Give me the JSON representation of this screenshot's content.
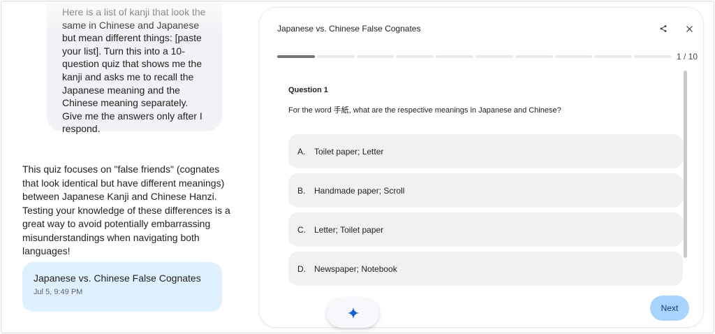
{
  "chat": {
    "user_prompt": "Here is a list of kanji that look the same in Chinese and Japanese but mean different things: [paste your list]. Turn this into a 10-question quiz that shows me the kanji and asks me to recall the Japanese meaning and the Chinese meaning separately. Give me the answers only after I respond.",
    "model_response": "This quiz focuses on \"false friends\" (cognates that look identical but have different meanings) between Japanese Kanji and Chinese Hanzi. Testing your knowledge of these differences is a great way to avoid potentially embarrassing misunderstandings when navigating both languages!",
    "quiz_chip": {
      "title": "Japanese vs. Chinese False Cognates",
      "date": "Jul 5, 9:49 PM"
    }
  },
  "panel": {
    "title": "Japanese vs. Chinese False Cognates",
    "share_icon": "share-icon",
    "close_icon": "close-icon",
    "progress": {
      "current": 1,
      "total": 10,
      "label": "1 / 10"
    },
    "question": {
      "number_label": "Question 1",
      "text": "For the word 手紙, what are the respective meanings in Japanese and Chinese?",
      "options": [
        {
          "letter": "A.",
          "text": "Toilet paper; Letter"
        },
        {
          "letter": "B.",
          "text": "Handmade paper; Scroll"
        },
        {
          "letter": "C.",
          "text": "Letter; Toilet paper"
        },
        {
          "letter": "D.",
          "text": "Newspaper; Notebook"
        }
      ]
    },
    "next_label": "Next"
  },
  "fab": {
    "icon": "sparkle-icon"
  },
  "colors": {
    "accent_button": "#a8d3ff",
    "quiz_chip": "#dff1ff",
    "user_bubble": "#f0f2f5",
    "sparkle": "#1a5fd1"
  }
}
